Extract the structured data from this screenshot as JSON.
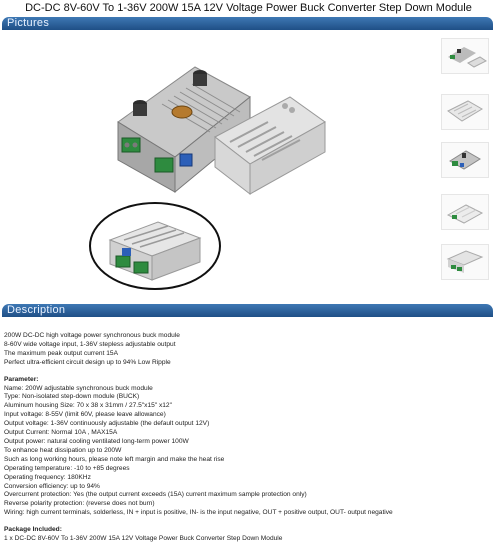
{
  "page": {
    "title": "DC-DC 8V-60V To 1-36V 200W 15A 12V Voltage Power Buck Converter Step Down Module"
  },
  "sections": {
    "pictures_label": "Pictures",
    "description_label": "Description"
  },
  "gallery": {
    "thumbnails": [
      "module-with-cover",
      "cover-top",
      "module-angle",
      "module-side",
      "module-front"
    ]
  },
  "description": {
    "intro": [
      "200W DC-DC high voltage power synchronous buck module",
      "8-60V wide voltage input, 1-36V stepless adjustable output",
      "The maximum peak output current 15A",
      "Perfect ultra-efficient circuit design up to 94% Low Ripple"
    ],
    "parameter_heading": "Parameter:",
    "parameters": [
      "Name: 200W adjustable synchronous buck module",
      "Type: Non-isolated step-down module (BUCK)",
      "Aluminum housing Size: 70 x 38 x 31mm / 27.5\"x15\" x12\"",
      "Input voltage: 8-55V (limit 60V, please leave allowance)",
      "Output voltage: 1-36V continuously adjustable (the default output 12V)",
      "Output Current: Normal 10A , MAX15A",
      "Output power: natural cooling ventilated long-term power 100W",
      "To enhance heat dissipation up to 200W",
      "Such as long working hours, please note left margin and make the heat rise",
      "Operating temperature: -10 to +85 degrees",
      "Operating frequency: 180KHz",
      "Conversion efficiency: up to 94%",
      "Overcurrent protection: Yes (the output current exceeds (15A) current maximum sample protection only)",
      "Reverse polarity protection: (reverse does not burn)",
      "Wiring: high current terminals, solderless, IN + input is positive, IN- is the input negative, OUT + positive output, OUT- output negative"
    ],
    "package_heading": "Package Included:",
    "package_items": [
      "1 x DC-DC 8V-60V To 1-36V 200W 15A 12V Voltage Power Buck Converter Step Down Module"
    ]
  }
}
